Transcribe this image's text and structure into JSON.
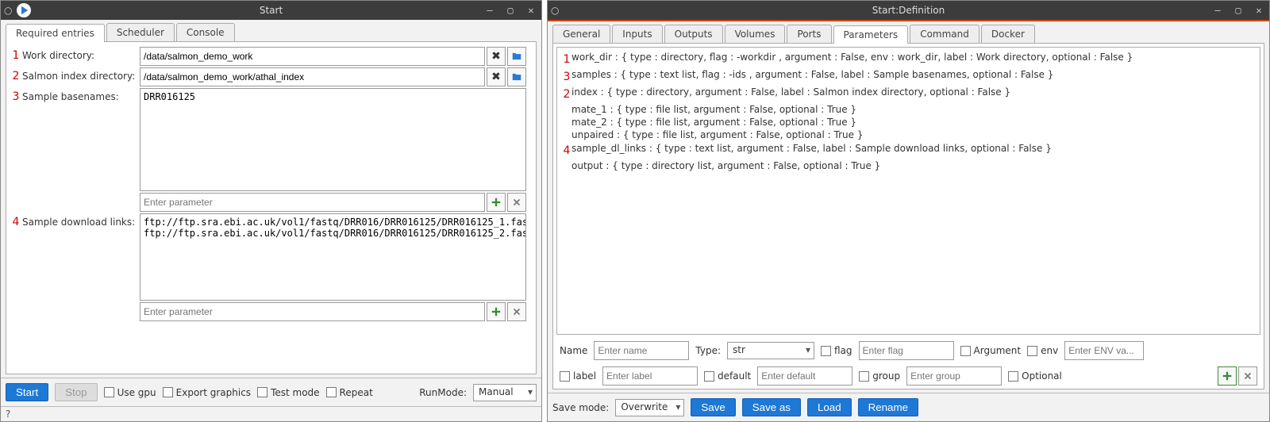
{
  "left": {
    "title": "Start",
    "tabs": [
      "Required entries",
      "Scheduler",
      "Console"
    ],
    "activeTab": 0,
    "annotations": [
      "1",
      "2",
      "3",
      "4"
    ],
    "fields": {
      "work_dir": {
        "label": "Work directory:",
        "value": "/data/salmon_demo_work"
      },
      "index": {
        "label": "Salmon index directory:",
        "value": "/data/salmon_demo_work/athal_index"
      },
      "samples": {
        "label": "Sample basenames:",
        "value": "DRR016125",
        "param_placeholder": "Enter parameter"
      },
      "links": {
        "label": "Sample download links:",
        "value": "ftp://ftp.sra.ebi.ac.uk/vol1/fastq/DRR016/DRR016125/DRR016125_1.fas\nftp://ftp.sra.ebi.ac.uk/vol1/fastq/DRR016/DRR016125/DRR016125_2.fas",
        "param_placeholder": "Enter parameter"
      }
    },
    "bottom": {
      "start": "Start",
      "stop": "Stop",
      "use_gpu": "Use gpu",
      "export_graphics": "Export graphics",
      "test_mode": "Test mode",
      "repeat": "Repeat",
      "runmode_label": "RunMode:",
      "runmode_value": "Manual"
    },
    "help": "?"
  },
  "right": {
    "title": "Start:Definition",
    "tabs": [
      "General",
      "Inputs",
      "Outputs",
      "Volumes",
      "Ports",
      "Parameters",
      "Command",
      "Docker"
    ],
    "activeTab": 5,
    "lines": [
      {
        "ann": "1",
        "text": "work_dir : { type : directory,  flag : -workdir ,  argument : False,  env : work_dir,  label : Work directory,  optional : False }"
      },
      {
        "ann": "3",
        "text": "samples : { type : text list,  flag : -ids ,  argument : False,  label : Sample basenames,  optional : False }"
      },
      {
        "ann": "2",
        "text": "index : { type : directory,  argument : False,  label : Salmon index directory,  optional : False }"
      },
      {
        "ann": "",
        "text": "mate_1 : { type : file list,  argument : False,  optional : True }"
      },
      {
        "ann": "",
        "text": "mate_2 : { type : file list,  argument : False,  optional : True }"
      },
      {
        "ann": "",
        "text": "unpaired : { type : file list,  argument : False,  optional : True }"
      },
      {
        "ann": "4",
        "text": "sample_dl_links : { type : text list,  argument : False,  label : Sample download links,  optional : False }"
      },
      {
        "ann": "",
        "text": "output : { type : directory list,  argument : False,  optional : True }"
      }
    ],
    "form1": {
      "name_label": "Name",
      "name_placeholder": "Enter name",
      "type_label": "Type:",
      "type_value": "str",
      "flag_label": "flag",
      "flag_placeholder": "Enter flag",
      "arg_label": "Argument",
      "env_label": "env",
      "env_placeholder": "Enter ENV va..."
    },
    "form2": {
      "label_label": "label",
      "label_placeholder": "Enter label",
      "default_label": "default",
      "default_placeholder": "Enter default",
      "group_label": "group",
      "group_placeholder": "Enter group",
      "optional_label": "Optional"
    },
    "bottom": {
      "savemode_label": "Save mode:",
      "savemode_value": "Overwrite",
      "save": "Save",
      "saveas": "Save as",
      "load": "Load",
      "rename": "Rename"
    }
  }
}
